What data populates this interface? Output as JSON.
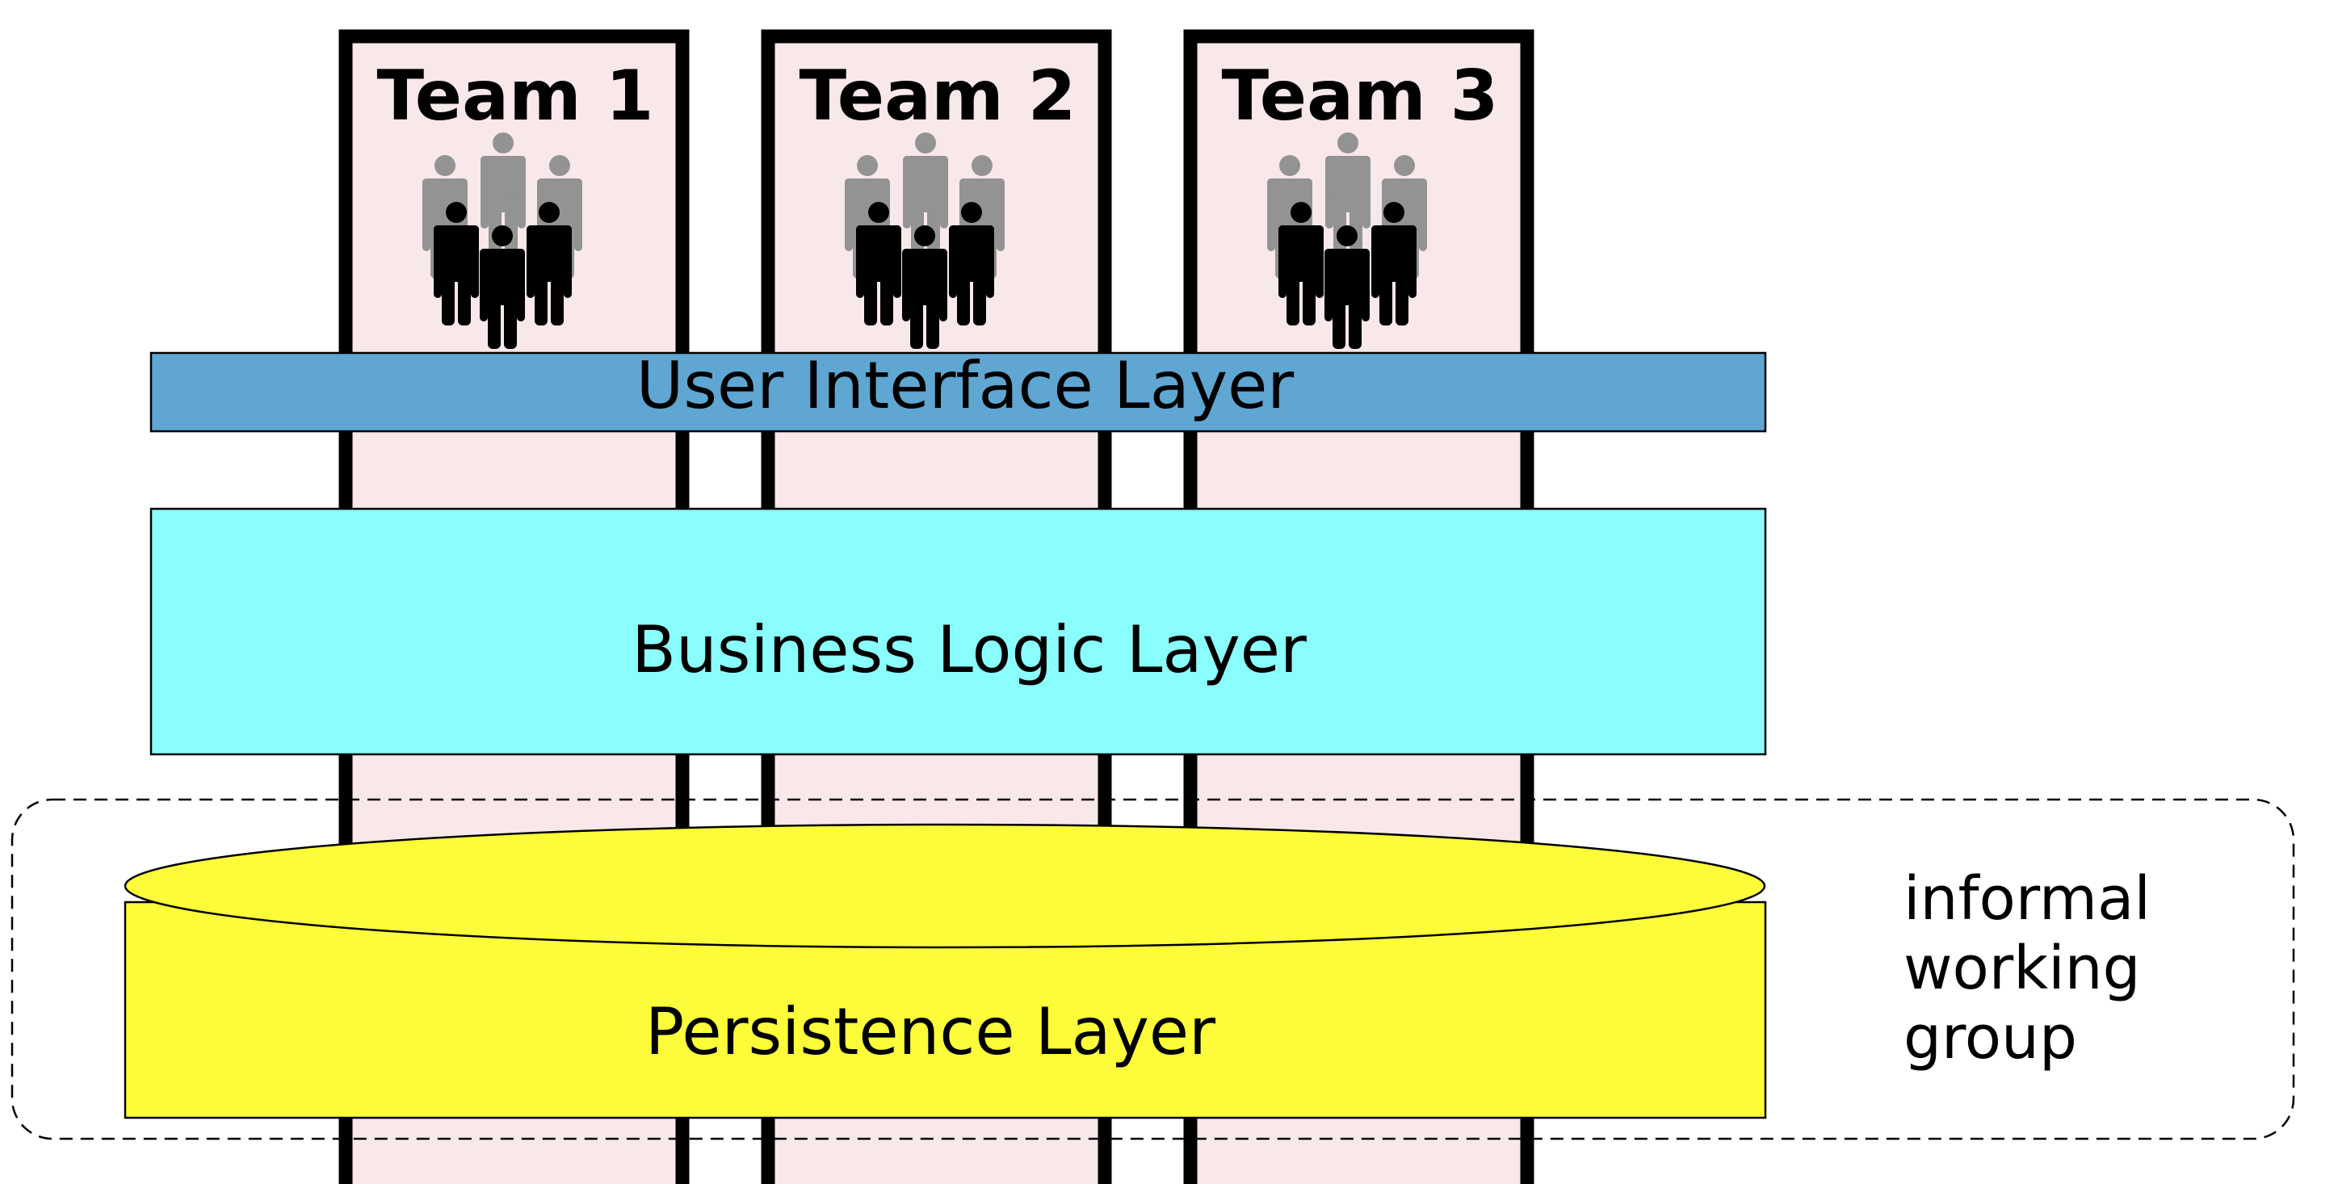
{
  "teams": [
    {
      "label": "Team 1"
    },
    {
      "label": "Team 2"
    },
    {
      "label": "Team 3"
    }
  ],
  "layers": {
    "ui": {
      "label": "User Interface Layer",
      "color": "#5fa6d2"
    },
    "business": {
      "label": "Business Logic Layer",
      "color": "#8afdfd"
    },
    "persistence": {
      "label": "Persistence Layer",
      "color": "#fcfc3a"
    }
  },
  "working_group": {
    "line1": "informal",
    "line2": "working",
    "line3": "group"
  },
  "colors": {
    "team_fill": "#f8e8ea",
    "member_back": "#939393",
    "member_front": "#000000"
  },
  "icons": {
    "team_members": "people-group-icon"
  }
}
